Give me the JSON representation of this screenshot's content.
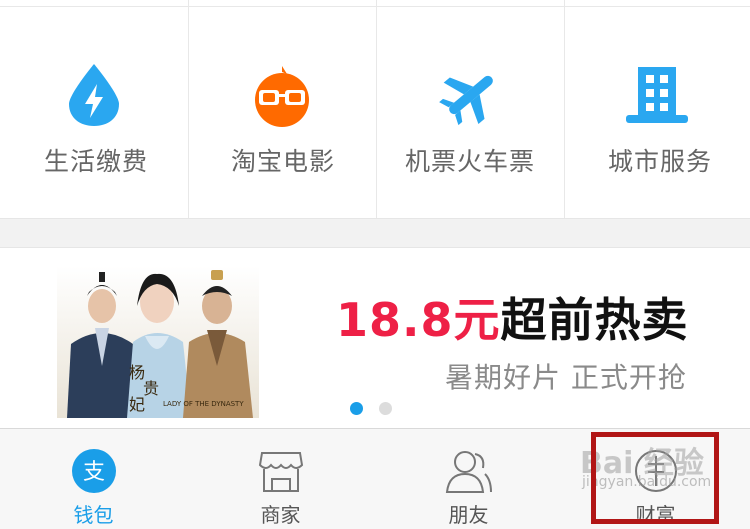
{
  "services": [
    {
      "label": "生活缴费",
      "icon": "water-drop-lightning-icon",
      "color": "#2aa7f0"
    },
    {
      "label": "淘宝电影",
      "icon": "glasses-character-icon",
      "color": "#ff6a00"
    },
    {
      "label": "机票火车票",
      "icon": "airplane-icon",
      "color": "#2aa7f0"
    },
    {
      "label": "城市服务",
      "icon": "city-building-icon",
      "color": "#2aa7f0"
    }
  ],
  "banner": {
    "price": "18.8元",
    "promo": "超前热卖",
    "subtitle": "暑期好片 正式开抢",
    "poster_title": "杨贵妃",
    "poster_subtitle": "LADY OF THE DYNASTY",
    "price_color": "#ee2046",
    "carousel_active_index": 0,
    "carousel_count": 2
  },
  "tabs": [
    {
      "label": "钱包",
      "icon": "alipay-icon",
      "active": true
    },
    {
      "label": "商家",
      "icon": "store-icon",
      "active": false
    },
    {
      "label": "朋友",
      "icon": "friends-icon",
      "active": false
    },
    {
      "label": "财富",
      "icon": "wealth-icon",
      "active": false
    }
  ],
  "watermark": {
    "text": "Bai 经验",
    "url_text": "jingyan.baidu.com"
  },
  "accent_color": "#1a9ee8"
}
